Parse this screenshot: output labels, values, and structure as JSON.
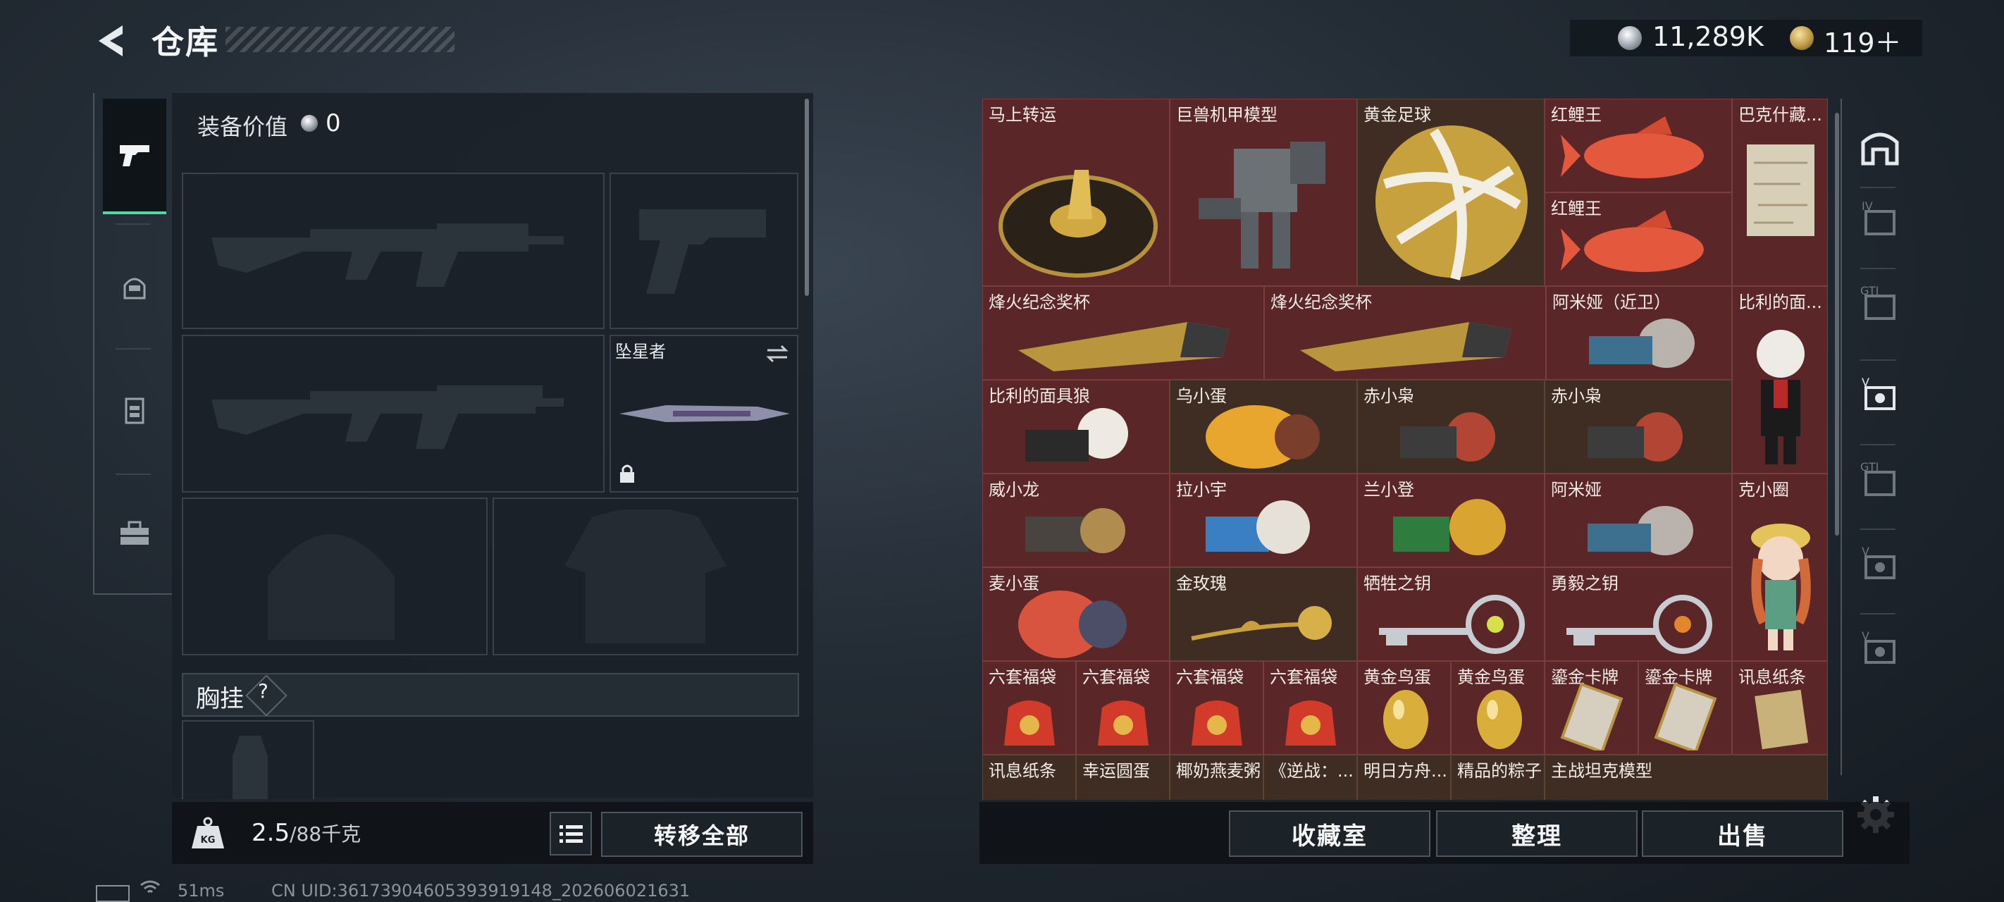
{
  "header": {
    "title": "仓库",
    "coin_value": "11,289K",
    "ticket_value": "119＋"
  },
  "equipment": {
    "value_label": "装备价值",
    "value_num": "0",
    "melee_name": "坠星者",
    "chest_label": "胸挂",
    "chest_help": "?"
  },
  "weight": {
    "current": "2.5",
    "capacity": "/88千克"
  },
  "buttons": {
    "transfer_all": "转移全部",
    "collection": "收藏室",
    "organize": "整理",
    "sell": "出售"
  },
  "storage_items": [
    "马上转运",
    "巨兽机甲模型",
    "黄金足球",
    "红鲤王",
    "巴克什藏...",
    "红鲤王",
    "烽火纪念奖杯",
    "烽火纪念奖杯",
    "阿米娅（近卫）",
    "比利的面...",
    "比利的面具狼",
    "乌小蛋",
    "赤小枭",
    "赤小枭",
    "威小龙",
    "拉小宇",
    "兰小登",
    "阿米娅",
    "克小圈",
    "麦小蛋",
    "金玫瑰",
    "牺牲之钥",
    "勇毅之钥",
    "六套福袋",
    "六套福袋",
    "六套福袋",
    "六套福袋",
    "黄金鸟蛋",
    "黄金鸟蛋",
    "鎏金卡牌",
    "鎏金卡牌",
    "讯息纸条",
    "讯息纸条",
    "幸运圆蛋",
    "椰奶燕麦粥",
    "《逆战：...",
    "明日方舟...",
    "精品的粽子",
    "主战坦克模型"
  ],
  "status": {
    "ping": "51ms",
    "uid": "CN UID:36173904605393919148_202606021631"
  },
  "colors": {
    "accent_green": "#56d6a0",
    "cell_red": "#5b2628",
    "cell_brown": "#3f2d24"
  },
  "icons": {
    "back": "chevron-left-icon",
    "coin": "silver-coin-icon",
    "ticket": "gold-ticket-icon",
    "tab_weapons": "pistol-icon",
    "tab_armor": "helmet-icon",
    "tab_vest": "vest-icon",
    "tab_toolbox": "toolbox-icon",
    "swap": "swap-arrows-icon",
    "lock": "lock-icon",
    "weight": "kg-weight-icon",
    "list": "list-icon",
    "settings": "gear-icon"
  }
}
